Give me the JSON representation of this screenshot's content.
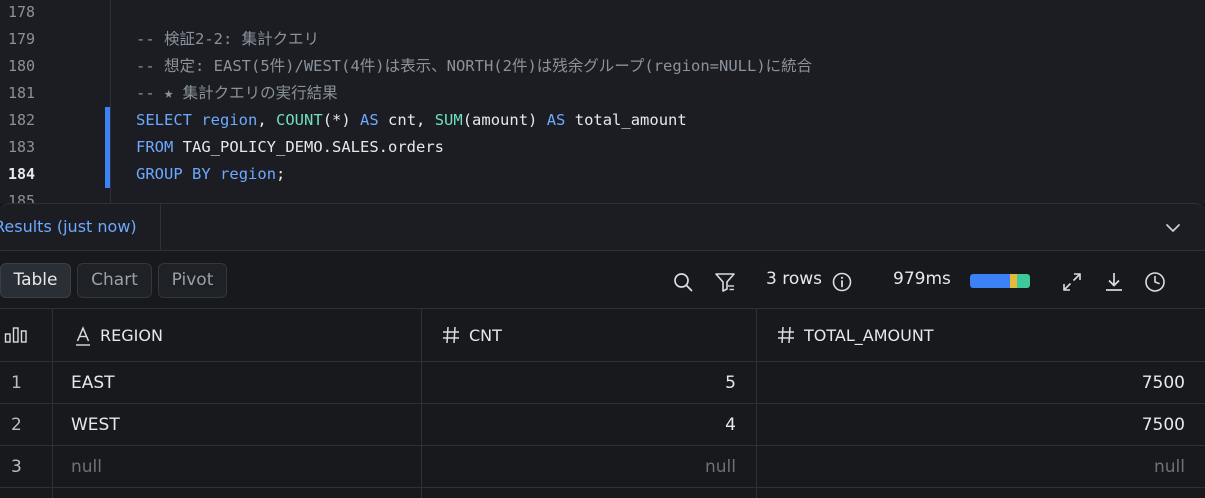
{
  "editor": {
    "lines": [
      {
        "num": "178",
        "text": ""
      },
      {
        "num": "179",
        "text": "-- 検証2-2: 集計クエリ"
      },
      {
        "num": "180",
        "text": "-- 想定: EAST(5件)/WEST(4件)は表示、NORTH(2件)は残余グループ(region=NULL)に統合"
      },
      {
        "num": "181",
        "text": "-- ★ 集計クエリの実行結果"
      },
      {
        "num": "182",
        "text": "SELECT region, COUNT(*) AS cnt, SUM(amount) AS total_amount"
      },
      {
        "num": "183",
        "text": "FROM TAG_POLICY_DEMO.SALES.orders"
      },
      {
        "num": "184",
        "text": "GROUP BY region;"
      },
      {
        "num": "185",
        "text": ""
      }
    ],
    "active_line": "184"
  },
  "results": {
    "tab_label": "Results (just now)",
    "view_tabs": [
      "Table",
      "Chart",
      "Pivot"
    ],
    "selected_view": "Table",
    "rows_label": "3 rows",
    "duration": "979ms",
    "timing_colors": [
      "#3b82f6",
      "#e7b93b",
      "#3ec99a"
    ]
  },
  "table": {
    "columns": [
      {
        "name": "REGION",
        "type_icon": "text-type-icon"
      },
      {
        "name": "CNT",
        "type_icon": "number-type-icon"
      },
      {
        "name": "TOTAL_AMOUNT",
        "type_icon": "number-type-icon"
      }
    ],
    "rows": [
      {
        "n": "1",
        "region": "EAST",
        "cnt": "5",
        "total": "7500"
      },
      {
        "n": "2",
        "region": "WEST",
        "cnt": "4",
        "total": "7500"
      },
      {
        "n": "3",
        "region": "null",
        "cnt": "null",
        "total": "null"
      }
    ]
  }
}
